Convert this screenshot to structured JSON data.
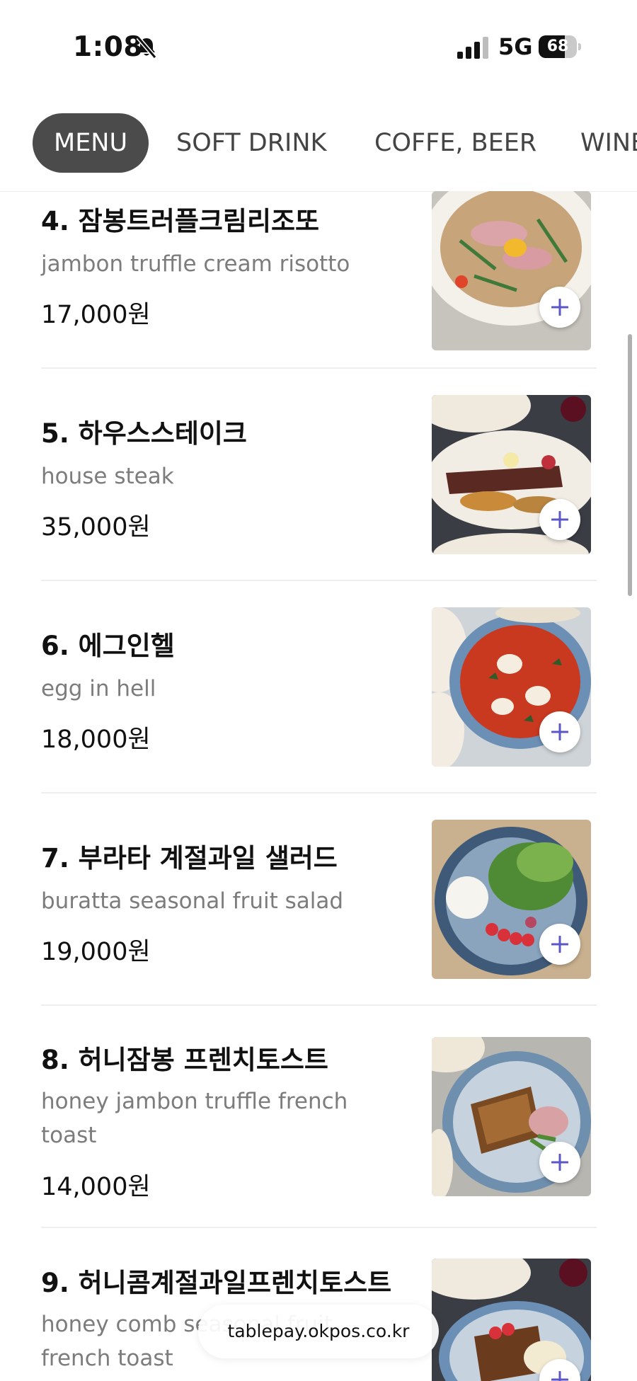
{
  "status_bar": {
    "time": "1:08",
    "network": "5G",
    "battery_level": "68",
    "battery_fraction": 0.68
  },
  "tabs": [
    {
      "label": "MENU",
      "active": true
    },
    {
      "label": "SOFT DRINK",
      "active": false
    },
    {
      "label": "COFFE, BEER",
      "active": false
    },
    {
      "label": "WINE",
      "active": false
    }
  ],
  "menu_items": [
    {
      "name": "4. 잠봉트러플크림리조또",
      "desc": "jambon truffle cream risotto",
      "price": "17,000원"
    },
    {
      "name": "5. 하우스스테이크",
      "desc": "house steak",
      "price": "35,000원"
    },
    {
      "name": "6. 에그인헬",
      "desc": "egg in hell",
      "price": "18,000원"
    },
    {
      "name": "7. 부라타 계절과일 샐러드",
      "desc": "buratta seasonal fruit salad",
      "price": "19,000원"
    },
    {
      "name": "8. 허니잠봉 프렌치토스트",
      "desc": "honey jambon truffle french toast",
      "price": "14,000원"
    },
    {
      "name": "9. 허니콤계절과일프렌치토스트",
      "desc": "honey comb seasonal fruit french toast",
      "price": ""
    }
  ],
  "browser": {
    "url": "tablepay.okpos.co.kr"
  },
  "colors": {
    "accent": "#5b57c7",
    "active_tab_bg": "#4b4b4b",
    "desc_text": "#7c7c7c"
  },
  "icons": {
    "add": "plus-icon",
    "bell": "bell-slash-icon",
    "signal": "cellular-signal-icon",
    "battery": "battery-icon"
  }
}
